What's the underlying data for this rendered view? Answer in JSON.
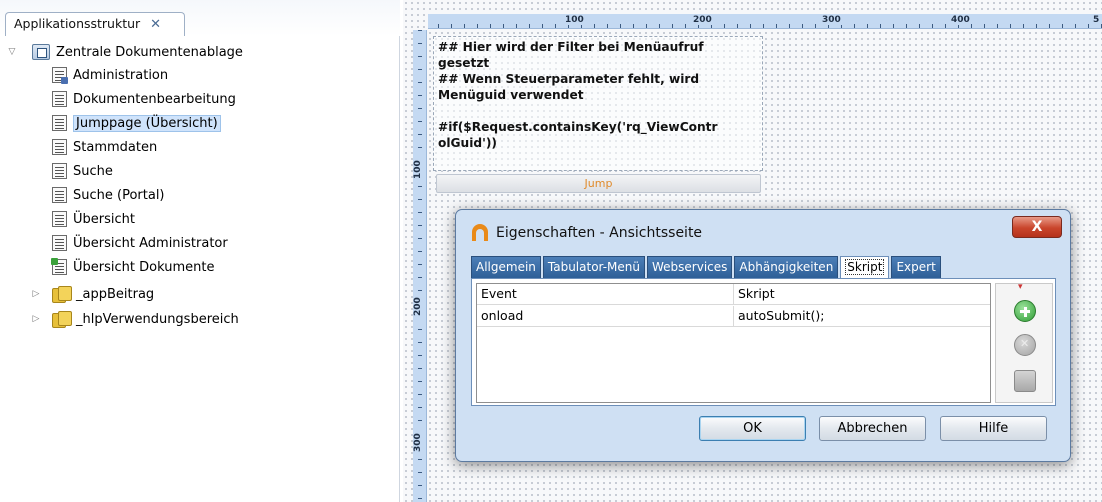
{
  "tree_panel": {
    "tab_label": "Applikationsstruktur",
    "tab_close": "✕",
    "root": {
      "label": "Zentrale Dokumentenablage",
      "expanded": true
    },
    "items": [
      {
        "label": "Administration",
        "icon": "page-admin-icon"
      },
      {
        "label": "Dokumentenbearbeitung",
        "icon": "page-icon"
      },
      {
        "label": "Jumppage (Übersicht)",
        "icon": "page-icon",
        "selected": true
      },
      {
        "label": "Stammdaten",
        "icon": "page-icon"
      },
      {
        "label": "Suche",
        "icon": "page-icon"
      },
      {
        "label": "Suche (Portal)",
        "icon": "page-icon"
      },
      {
        "label": "Übersicht",
        "icon": "page-icon"
      },
      {
        "label": "Übersicht Administrator",
        "icon": "page-icon"
      },
      {
        "label": "Übersicht Dokumente",
        "icon": "page-start-icon"
      }
    ],
    "groups": [
      {
        "label": "_appBeitrag",
        "expanded": false
      },
      {
        "label": "_hlpVerwendungsbereich",
        "expanded": false
      }
    ]
  },
  "canvas": {
    "ruler_top": [
      "100",
      "200",
      "300",
      "400",
      "5"
    ],
    "ruler_left": [
      "100",
      "200",
      "300"
    ],
    "script_lines": [
      "## Hier wird der Filter bei Menüaufruf",
      "gesetzt",
      "## Wenn Steuerparameter fehlt, wird",
      "Menüguid verwendet",
      "",
      "#if($Request.containsKey('rq_ViewContr",
      "olGuid'))"
    ],
    "jump_button_label": "Jump"
  },
  "dialog": {
    "title": "Eigenschaften - Ansichtsseite",
    "close_label": "X",
    "tabs": [
      {
        "label": "Allgemein",
        "active": false
      },
      {
        "label": "Tabulator-Menü",
        "active": false
      },
      {
        "label": "Webservices",
        "active": false
      },
      {
        "label": "Abhängigkeiten",
        "active": false
      },
      {
        "label": "Skript",
        "active": true
      },
      {
        "label": "Expert",
        "active": false
      }
    ],
    "grid": {
      "columns": [
        "Event",
        "Skript"
      ],
      "rows": [
        [
          "onload",
          "autoSubmit();"
        ]
      ]
    },
    "buttons": {
      "ok": "OK",
      "cancel": "Abbrechen",
      "help": "Hilfe"
    }
  },
  "colors": {
    "accent": "#2e5f97",
    "selection": "#cfe3fb",
    "dialog_bg": "#cfe0f3",
    "jump_text": "#e08a2a",
    "close_red": "#c9452c"
  }
}
